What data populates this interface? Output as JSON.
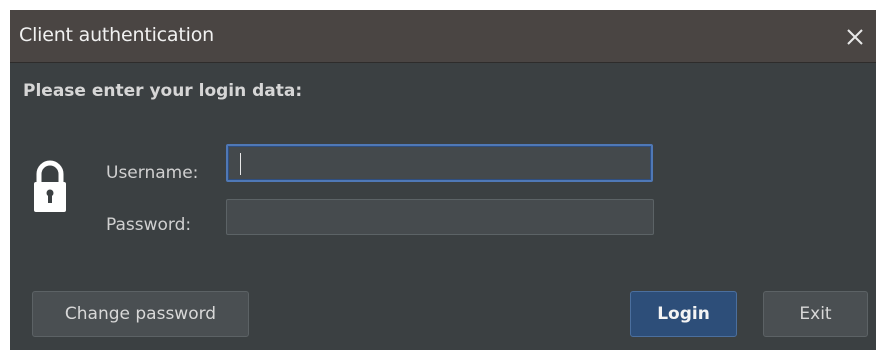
{
  "window": {
    "title": "Client authentication",
    "close_icon": "close-icon"
  },
  "header": {
    "text": "Please enter your login data:"
  },
  "form": {
    "lock_icon": "padlock-icon",
    "username_label": "Username:",
    "username_value": "",
    "password_label": "Password:",
    "password_value": ""
  },
  "buttons": {
    "change_password": "Change password",
    "login": "Login",
    "exit": "Exit"
  },
  "colors": {
    "background": "#3b4042",
    "titlebar": "#4a4543",
    "accent_focus": "#4f78b6",
    "login_button": "#2d4e79"
  }
}
